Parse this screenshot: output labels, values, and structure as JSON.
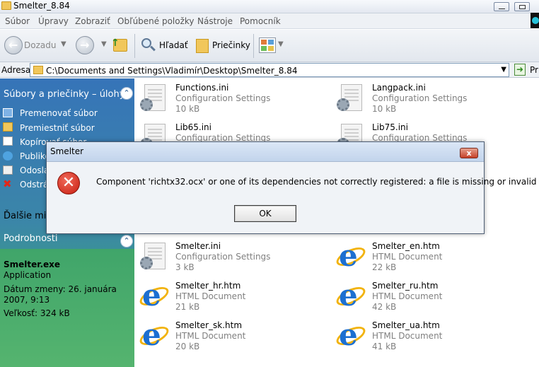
{
  "window": {
    "title": "Smelter_8.84"
  },
  "menu": [
    "Súbor",
    "Úpravy",
    "Zobraziť",
    "Obľúbené položky",
    "Nástroje",
    "Pomocník"
  ],
  "toolbar": {
    "back_label": "Dozadu",
    "search_label": "Hľadať",
    "folders_label": "Priečinky"
  },
  "address": {
    "label": "Adresa",
    "path": "C:\\Documents and Settings\\Vladimír\\Desktop\\Smelter_8.84",
    "go_label": "Pr"
  },
  "left_panel": {
    "tasks_header": "Súbory a priečinky – úlohy",
    "tasks": [
      "Premenovať súbor",
      "Premiestniť súbor",
      "Kopírovať súbor",
      "Publikovať",
      "Odoslať",
      "Odstrániť"
    ],
    "other_places_header": "Ďalšie miesta",
    "details_header": "Podrobnosti",
    "details": {
      "name": "Smelter.exe",
      "kind": "Application",
      "modified": "Dátum zmeny: 26. januára 2007, 9:13",
      "size": "Veľkosť: 324 kB"
    }
  },
  "files": [
    {
      "name": "Functions.ini",
      "type": "Configuration Settings",
      "size": "10 kB",
      "icon": "ini-icon"
    },
    {
      "name": "Langpack.ini",
      "type": "Configuration Settings",
      "size": "10 kB",
      "icon": "ini-icon"
    },
    {
      "name": "Lib65.ini",
      "type": "Configuration Settings",
      "size": "",
      "icon": "ini-icon"
    },
    {
      "name": "Lib75.ini",
      "type": "Configuration Settings",
      "size": "",
      "icon": "ini-icon"
    },
    {
      "name": "Smelter.ini",
      "type": "Configuration Settings",
      "size": "3 kB",
      "icon": "ini-icon"
    },
    {
      "name": "Smelter_en.htm",
      "type": "HTML Document",
      "size": "22 kB",
      "icon": "ie-icon"
    },
    {
      "name": "Smelter_hr.htm",
      "type": "HTML Document",
      "size": "21 kB",
      "icon": "ie-icon"
    },
    {
      "name": "Smelter_ru.htm",
      "type": "HTML Document",
      "size": "42 kB",
      "icon": "ie-icon"
    },
    {
      "name": "Smelter_sk.htm",
      "type": "HTML Document",
      "size": "20 kB",
      "icon": "ie-icon"
    },
    {
      "name": "Smelter_ua.htm",
      "type": "HTML Document",
      "size": "41 kB",
      "icon": "ie-icon"
    }
  ],
  "dialog": {
    "title": "Smelter",
    "message": "Component 'richtx32.ocx' or one of its dependencies not correctly registered: a file is missing or invalid",
    "ok_label": "OK",
    "close_label": "x"
  },
  "colors": {
    "error": "#c81d10",
    "panel_top": "#3674b8",
    "panel_bottom": "#4db36f"
  }
}
